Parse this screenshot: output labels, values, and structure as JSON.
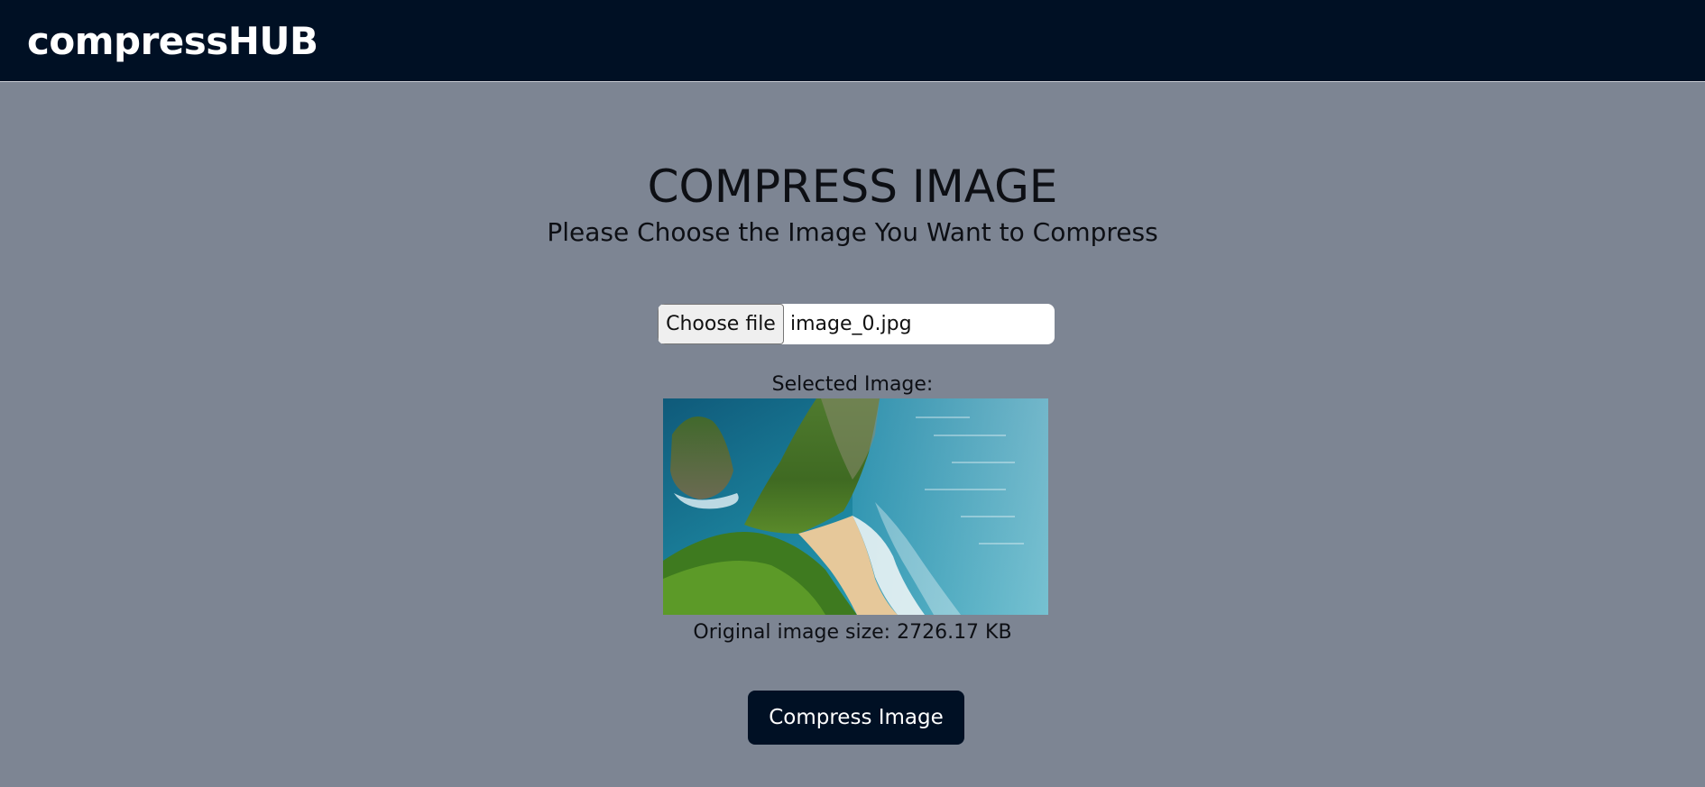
{
  "navbar": {
    "brand": "compressHUB"
  },
  "page": {
    "title": "COMPRESS IMAGE",
    "subtitle": "Please Choose the Image You Want to Compress"
  },
  "file_input": {
    "button_label": "Choose file",
    "file_name": "image_0.jpg"
  },
  "preview": {
    "label": "Selected Image:",
    "size_text": "Original image size: 2726.17 KB"
  },
  "actions": {
    "compress_label": "Compress Image"
  },
  "colors": {
    "navbar_bg": "#001024",
    "page_bg": "#7d8593",
    "button_bg": "#001024",
    "text": "#0d0f14"
  }
}
